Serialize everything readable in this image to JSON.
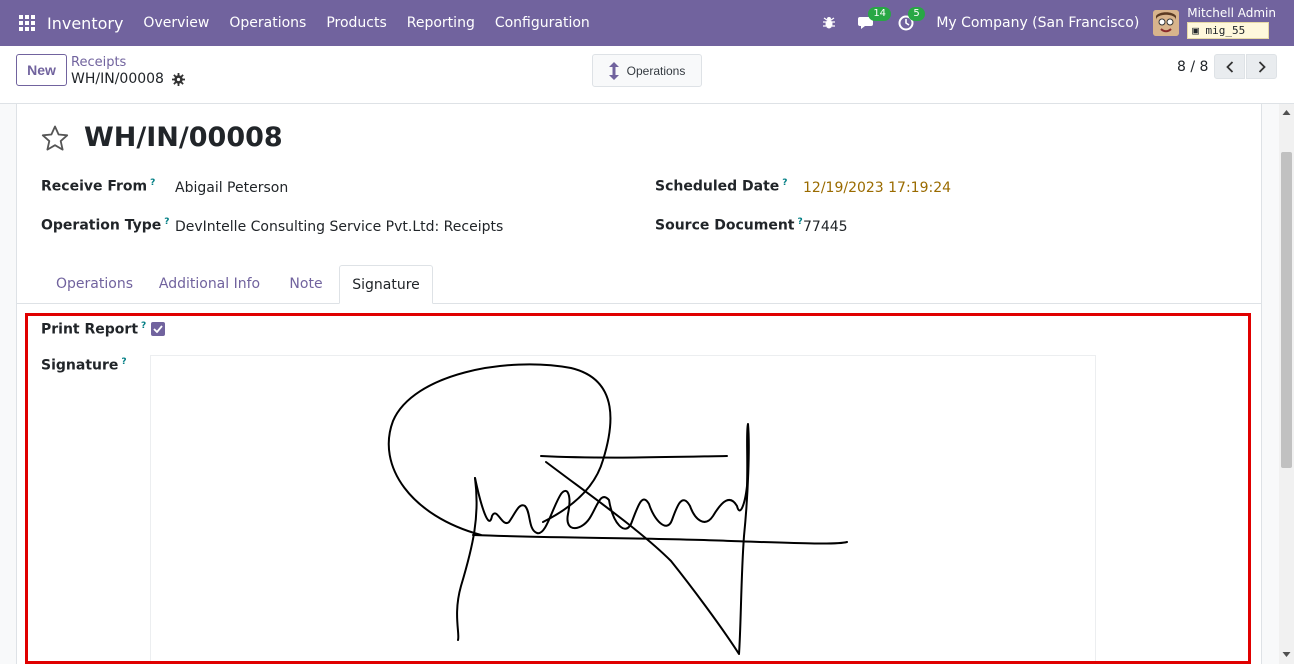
{
  "navbar": {
    "app_name": "Inventory",
    "menu": [
      "Overview",
      "Operations",
      "Products",
      "Reporting",
      "Configuration"
    ],
    "messages_count": "14",
    "activities_count": "5",
    "company": "My Company (San Francisco)",
    "user_name": "Mitchell Admin",
    "database": "mig_55"
  },
  "control_panel": {
    "new_label": "New",
    "breadcrumb_parent": "Receipts",
    "breadcrumb_current": "WH/IN/00008",
    "operations_label": "Operations",
    "pager": "8 / 8"
  },
  "form": {
    "title": "WH/IN/00008",
    "fields": {
      "receive_from_label": "Receive From",
      "receive_from_value": "Abigail Peterson",
      "operation_type_label": "Operation Type",
      "operation_type_value": "DevIntelle Consulting Service Pvt.Ltd: Receipts",
      "scheduled_date_label": "Scheduled Date",
      "scheduled_date_value": "12/19/2023 17:19:24",
      "source_document_label": "Source Document",
      "source_document_value": "77445"
    },
    "tooltip_mark": "?",
    "tabs": [
      "Operations",
      "Additional Info",
      "Note",
      "Signature"
    ],
    "active_tab": "Signature",
    "signature_tab": {
      "print_report_label": "Print Report",
      "print_report_checked": true,
      "signature_label": "Signature"
    }
  },
  "colors": {
    "brand": "#71639e",
    "highlight": "#e00000",
    "date": "#9a6b00",
    "badge": "#28a745"
  }
}
